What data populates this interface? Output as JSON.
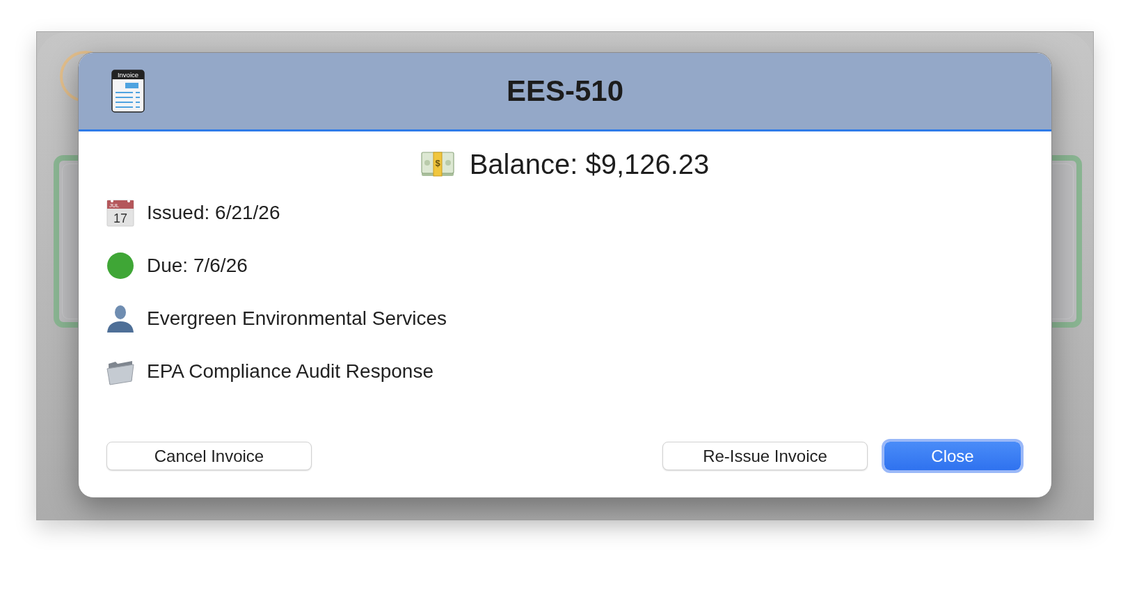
{
  "dialog": {
    "icon_label": "Invoice",
    "title": "EES-510",
    "balance": {
      "text": "Balance: $9,126.23",
      "icon_symbol": "$"
    },
    "details": [
      {
        "kind": "date",
        "text": "Issued: 6/21/26",
        "icon_month": "JUL",
        "icon_day": "17"
      },
      {
        "kind": "status",
        "text": "Due: 7/6/26",
        "color": "#3fa636"
      },
      {
        "kind": "client",
        "text": "Evergreen Environmental Services"
      },
      {
        "kind": "project",
        "text": "EPA Compliance Audit Response"
      }
    ],
    "footer": {
      "left": [
        {
          "label": "Cancel Invoice",
          "kind": "secondary"
        }
      ],
      "right": [
        {
          "label": "Re-Issue Invoice",
          "kind": "secondary"
        },
        {
          "label": "Close",
          "kind": "primary"
        }
      ]
    }
  }
}
